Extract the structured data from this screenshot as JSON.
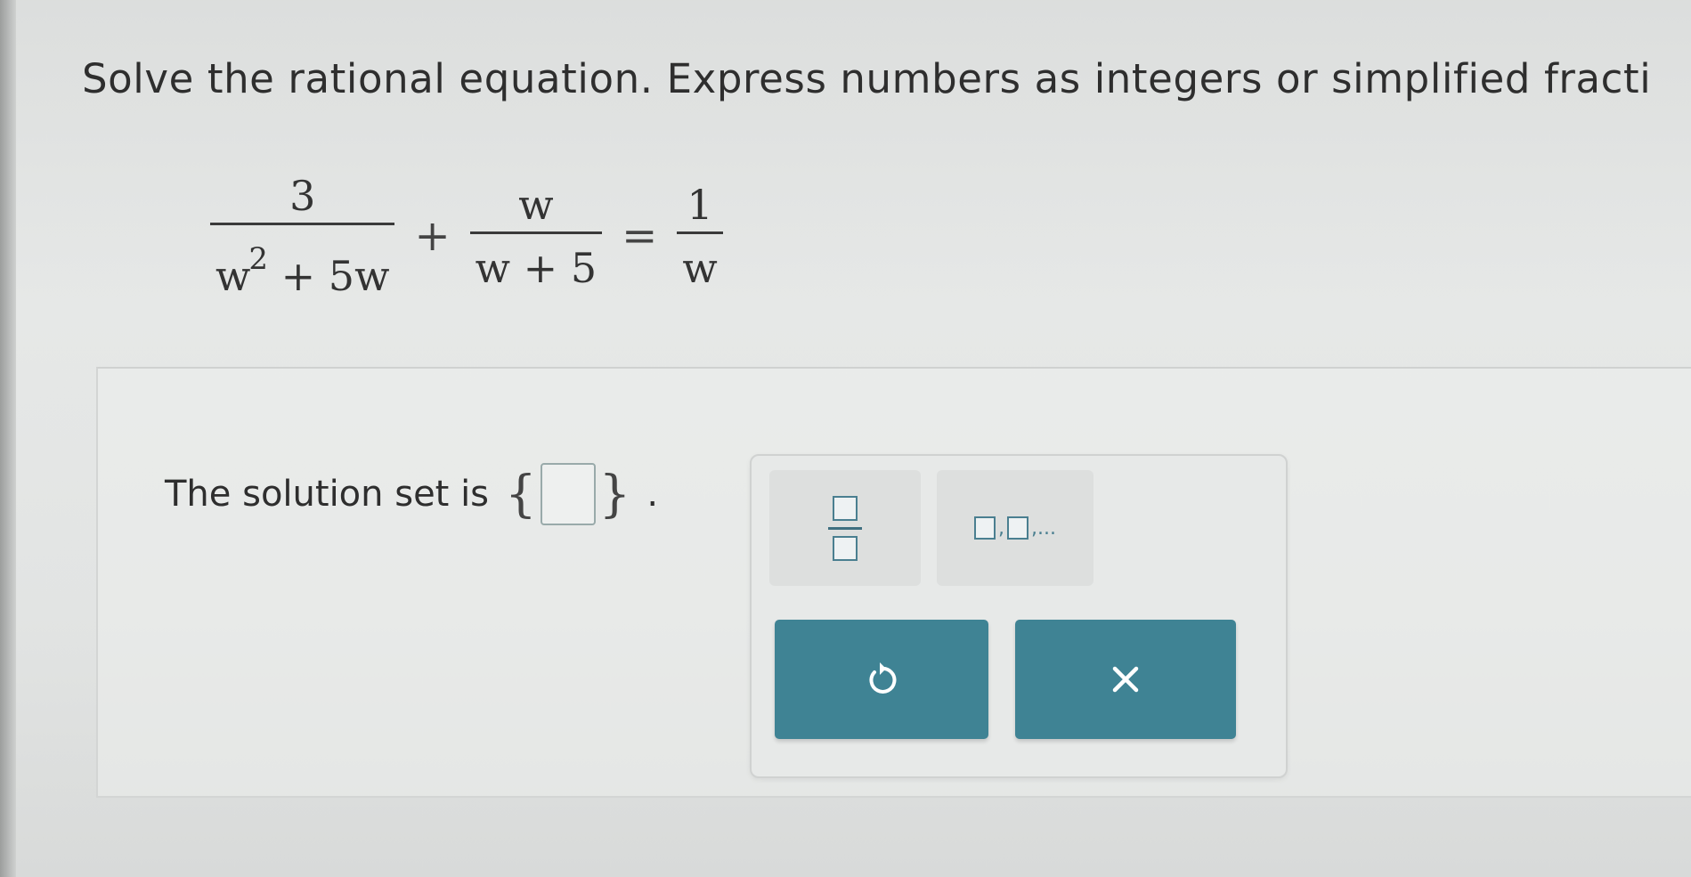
{
  "problem": {
    "instructions": "Solve the rational equation. Express numbers as integers or simplified fracti",
    "equation": {
      "term1": {
        "numerator": "3",
        "denominator_base": "w",
        "denominator_exp": "2",
        "denominator_rest": " + 5w"
      },
      "op1": "+",
      "term2": {
        "numerator": "w",
        "denominator": "w + 5"
      },
      "equals": "=",
      "term3": {
        "numerator": "1",
        "denominator": "w"
      }
    }
  },
  "answer": {
    "label": "The solution set is",
    "open_brace": "{",
    "close_brace": "}",
    "period": ".",
    "value": ""
  },
  "toolbox": {
    "fraction_tool_icon": "fraction-template-icon",
    "list_tool_icon": "list-template-icon",
    "list_separator": ",",
    "list_ellipsis": ",...",
    "undo_icon": "undo-icon",
    "clear_icon": "clear-x-icon"
  },
  "colors": {
    "button_teal": "#3f8394",
    "icon_teal": "#4a7f90",
    "background": "#e4e6e5"
  }
}
